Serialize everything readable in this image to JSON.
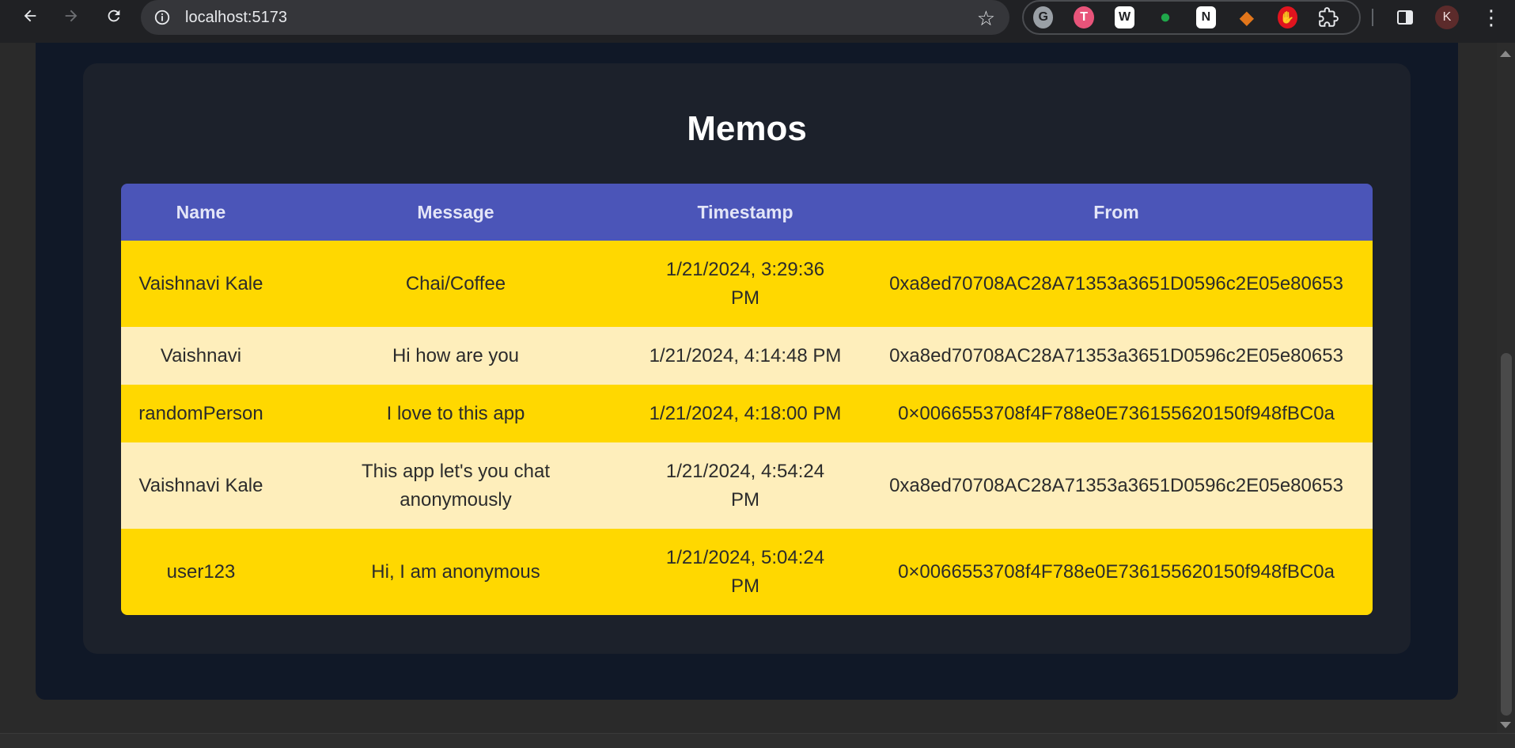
{
  "browser": {
    "url": "localhost:5173",
    "profile_initial": "K",
    "extensions": [
      {
        "icon": "grammarly-icon",
        "glyph": "G",
        "color": "#9aa0a6"
      },
      {
        "icon": "todoist-icon",
        "glyph": "T",
        "color": "#e8547a"
      },
      {
        "icon": "wikipedia-icon",
        "glyph": "W",
        "color": "#ffffff"
      },
      {
        "icon": "evernote-icon",
        "glyph": "E",
        "color": "#1fa74a"
      },
      {
        "icon": "notion-icon",
        "glyph": "N",
        "color": "#ffffff"
      },
      {
        "icon": "metamask-icon",
        "glyph": "M",
        "color": "#e2761b"
      },
      {
        "icon": "adblock-icon",
        "glyph": "✋",
        "color": "#e0141e"
      }
    ]
  },
  "page": {
    "title": "Memos"
  },
  "table": {
    "headers": [
      "Name",
      "Message",
      "Timestamp",
      "From"
    ],
    "rows": [
      {
        "name": "Vaishnavi Kale",
        "message": "Chai/Coffee",
        "timestamp": "1/21/2024, 3:29:36 PM",
        "from": "0xa8ed70708AC28A71353a3651D0596c2E05e80653"
      },
      {
        "name": "Vaishnavi",
        "message": "Hi how are you",
        "timestamp": "1/21/2024, 4:14:48 PM",
        "from": "0xa8ed70708AC28A71353a3651D0596c2E05e80653"
      },
      {
        "name": "randomPerson",
        "message": "I love to this app",
        "timestamp": "1/21/2024, 4:18:00 PM",
        "from": "0×0066553708f4F788e0E736155620150f948fBC0a"
      },
      {
        "name": "Vaishnavi Kale",
        "message": "This app let's you chat anonymously",
        "timestamp": "1/21/2024, 4:54:24 PM",
        "from": "0xa8ed70708AC28A71353a3651D0596c2E05e80653"
      },
      {
        "name": "user123",
        "message": "Hi, I am anonymous",
        "timestamp": "1/21/2024, 5:04:24 PM",
        "from": "0×0066553708f4F788e0E736155620150f948fBC0a"
      }
    ]
  },
  "colors": {
    "header_bg": "#4b55b8",
    "row_odd": "#ffd800",
    "row_even": "#feeebb",
    "card_bg": "#1c212b",
    "outer_bg": "#101827"
  }
}
